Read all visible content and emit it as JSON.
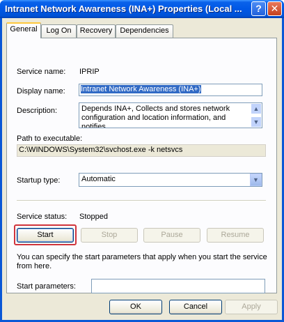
{
  "window": {
    "title": "Intranet Network Awareness (INA+) Properties (Local ...",
    "help_label": "?",
    "close_label": "✕"
  },
  "tabs": [
    {
      "label": "General",
      "active": true
    },
    {
      "label": "Log On",
      "active": false
    },
    {
      "label": "Recovery",
      "active": false
    },
    {
      "label": "Dependencies",
      "active": false
    }
  ],
  "general": {
    "service_name_label": "Service name:",
    "service_name": "IPRIP",
    "display_name_label": "Display name:",
    "display_name": "Intranet Network Awareness (INA+)",
    "description_label": "Description:",
    "description": "Depends INA+, Collects and stores network configuration and location information, and notifies",
    "path_label": "Path to executable:",
    "path": "C:\\WINDOWS\\System32\\svchost.exe -k netsvcs",
    "startup_type_label": "Startup type:",
    "startup_type": "Automatic",
    "service_status_label": "Service status:",
    "service_status": "Stopped",
    "buttons": {
      "start": "Start",
      "stop": "Stop",
      "pause": "Pause",
      "resume": "Resume"
    },
    "info_text": "You can specify the start parameters that apply when you start the service from here.",
    "start_params_label": "Start parameters:",
    "start_params_value": ""
  },
  "footer": {
    "ok": "OK",
    "cancel": "Cancel",
    "apply": "Apply"
  },
  "icons": {
    "scroll_up": "▲",
    "scroll_down": "▼",
    "dropdown": "▼"
  },
  "colors": {
    "titlebar": "#0058e6",
    "face": "#ece9d8",
    "highlight": "#d0343c",
    "selection": "#316ac5"
  }
}
